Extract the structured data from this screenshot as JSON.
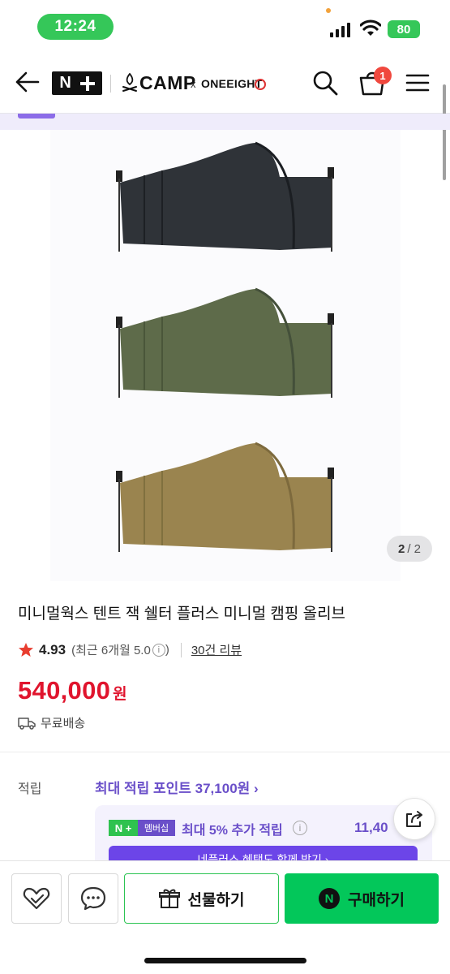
{
  "status_bar": {
    "time": "12:24",
    "battery": "80"
  },
  "header": {
    "brand_n": "N",
    "camp_text": "CAMP",
    "collab_x": "x",
    "collab_brand": "ONEEIGHT",
    "cart_count": "1"
  },
  "gallery": {
    "current": "2",
    "total": "/ 2"
  },
  "product": {
    "title": "미니멀웍스 텐트 잭 쉘터 플러스 미니멀 캠핑 올리브",
    "rating": "4.93",
    "recent_rating": "(최근 6개월 5.0",
    "recent_close": ")",
    "reviews": "30건 리뷰",
    "price": "540,000",
    "currency": "원",
    "shipping": "무료배송"
  },
  "points": {
    "label": "적립",
    "max_points": "최대 적립 포인트 37,100원 ›",
    "membership_np": "N +",
    "membership_label": "멤버십",
    "membership_text": "최대 5% 추가 적립",
    "membership_amount": "11,40",
    "membership_banner": "네플러스 혜택도 함께 받기 ›"
  },
  "bottom_bar": {
    "gift_label": "선물하기",
    "buy_label": "구매하기",
    "buy_icon": "N"
  },
  "colors": {
    "price_red": "#e0142d",
    "naver_green": "#03c75a",
    "membership_purple": "#6a4fc9",
    "tent_black": "#2f3338",
    "tent_olive": "#5e6b4a",
    "tent_coyote": "#9a844f"
  },
  "icons": [
    "back-arrow-icon",
    "search-icon",
    "shopping-bag-icon",
    "hamburger-menu-icon",
    "star-icon",
    "truck-icon",
    "info-icon",
    "share-icon",
    "heart-check-icon",
    "chat-bubble-icon",
    "gift-icon"
  ]
}
